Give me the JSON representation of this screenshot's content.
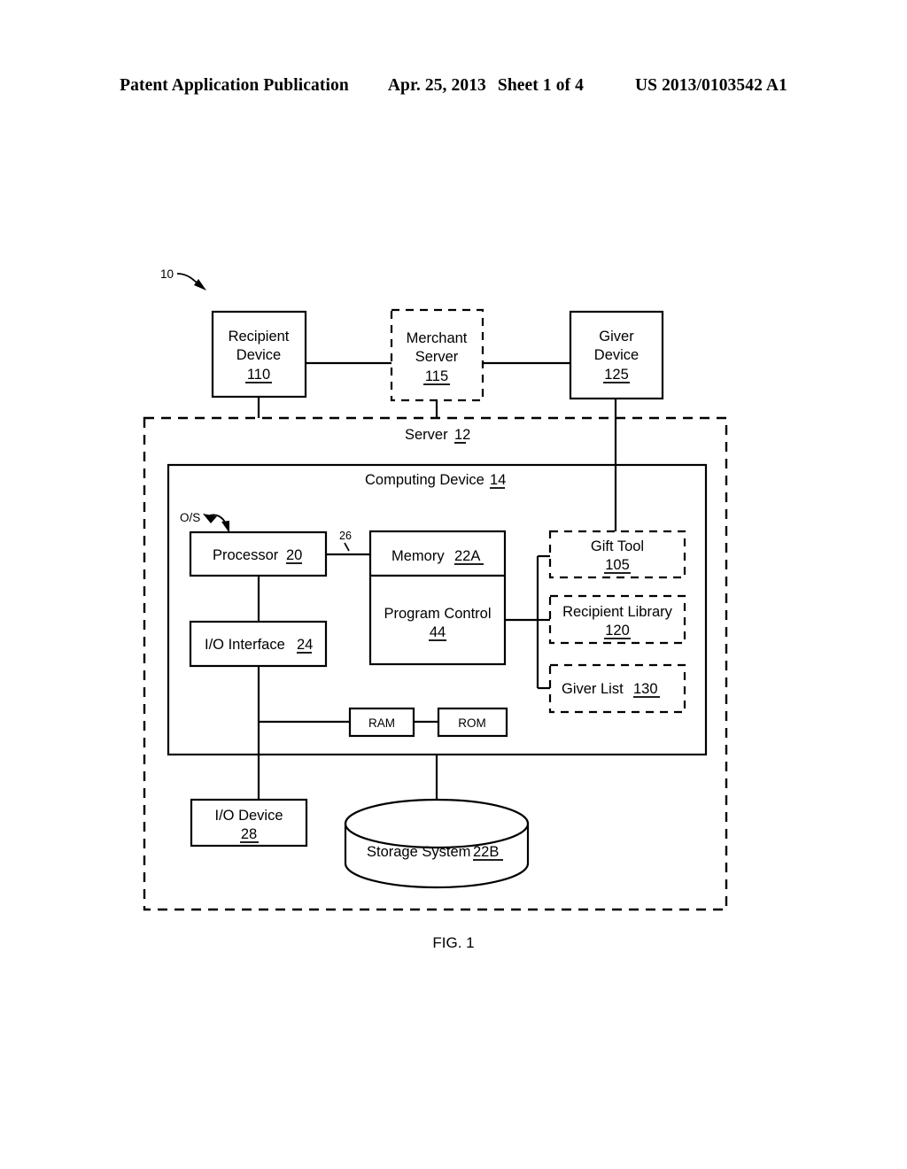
{
  "header": {
    "publication": "Patent Application Publication",
    "date": "Apr. 25, 2013",
    "sheet": "Sheet 1 of 4",
    "number": "US 2013/0103542 A1"
  },
  "figure": {
    "caption": "FIG. 1",
    "system_ref": "10",
    "os_label": "O/S",
    "bus_ref": "26"
  },
  "diagram": {
    "recipient_device": {
      "line1": "Recipient",
      "line2": "Device",
      "ref": "110"
    },
    "merchant_server": {
      "line1": "Merchant",
      "line2": "Server",
      "ref": "115"
    },
    "giver_device": {
      "line1": "Giver",
      "line2": "Device",
      "ref": "125"
    },
    "server": {
      "label": "Server",
      "ref": "12"
    },
    "computing_device": {
      "label": "Computing Device",
      "ref": "14"
    },
    "processor": {
      "label": "Processor",
      "ref": "20"
    },
    "io_interface": {
      "label": "I/O Interface",
      "ref": "24"
    },
    "memory": {
      "label": "Memory",
      "ref": "22A"
    },
    "program_control": {
      "label": "Program Control",
      "ref": "44"
    },
    "ram": {
      "label": "RAM"
    },
    "rom": {
      "label": "ROM"
    },
    "io_device": {
      "line1": "I/O Device",
      "ref": "28"
    },
    "storage_system": {
      "label": "Storage System",
      "ref": "22B"
    },
    "gift_tool": {
      "label": "Gift Tool",
      "ref": "105"
    },
    "recipient_library": {
      "label": "Recipient Library",
      "ref": "120"
    },
    "giver_list": {
      "label": "Giver List",
      "ref": "130"
    }
  }
}
